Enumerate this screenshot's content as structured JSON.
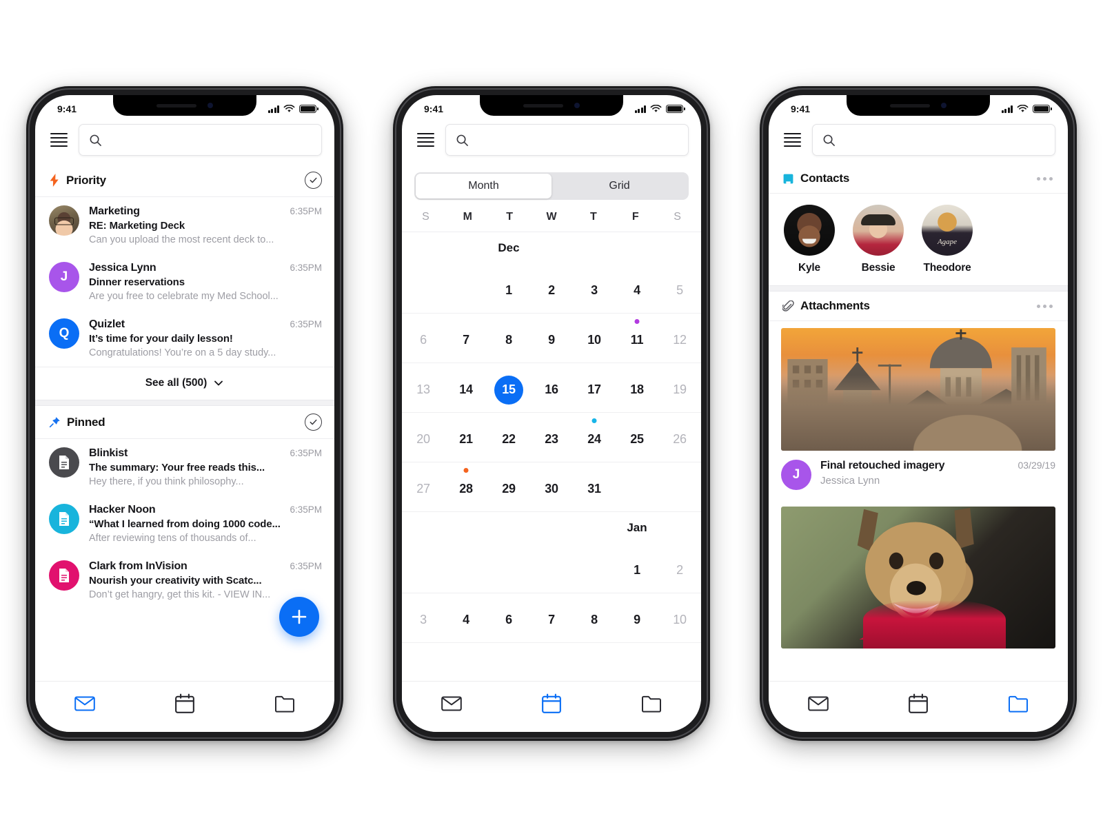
{
  "status": {
    "time": "9:41"
  },
  "search": {
    "placeholder": "",
    "value": "",
    "icon": "search-icon"
  },
  "phone_mail": {
    "priority": {
      "title": "Priority",
      "icon": "lightning-bolt-icon",
      "icon_color": "#f4631e",
      "action_icon": "check-circle-icon",
      "items": [
        {
          "from": "Marketing",
          "time": "6:35PM",
          "subject": "RE: Marketing Deck",
          "preview": "Can you upload the most recent deck to...",
          "avatar_type": "photo",
          "avatar_initial": ""
        },
        {
          "from": "Jessica Lynn",
          "time": "6:35PM",
          "subject": "Dinner reservations",
          "preview": "Are you free to celebrate my Med School...",
          "avatar_type": "initial",
          "avatar_initial": "J",
          "avatar_color": "#a855ea"
        },
        {
          "from": "Quizlet",
          "time": "6:35PM",
          "subject": "It’s time for your daily lesson!",
          "preview": "Congratulations! You’re on a 5 day study...",
          "avatar_type": "initial",
          "avatar_initial": "Q",
          "avatar_color": "#0a6ef5"
        }
      ],
      "see_all": "See all (500)",
      "see_all_icon": "chevron-down-icon"
    },
    "pinned": {
      "title": "Pinned",
      "icon": "pin-icon",
      "icon_color": "#1672f0",
      "action_icon": "check-circle-icon",
      "items": [
        {
          "from": "Blinkist",
          "time": "6:35PM",
          "subject": "The summary: Your free reads this...",
          "preview": "Hey there, if you think philosophy...",
          "avatar_type": "doc",
          "avatar_color": "#4a4a4e"
        },
        {
          "from": "Hacker Noon",
          "time": "6:35PM",
          "subject": "“What I learned from doing 1000 code...",
          "preview": "After reviewing tens of thousands of...",
          "avatar_type": "doc",
          "avatar_color": "#18b4dc"
        },
        {
          "from": "Clark from InVision",
          "time": "6:35PM",
          "subject": "Nourish your creativity with Scatc...",
          "preview": "Don’t get hangry, get this kit. - VIEW IN...",
          "avatar_type": "doc",
          "avatar_color": "#e1116e"
        }
      ]
    },
    "fab": {
      "label": "+",
      "icon": "plus-icon",
      "color": "#0a6ef5"
    },
    "tabs": [
      {
        "name": "mail",
        "icon": "mail-icon",
        "active": true
      },
      {
        "name": "calendar",
        "icon": "calendar-icon",
        "active": false
      },
      {
        "name": "folder",
        "icon": "folder-icon",
        "active": false
      }
    ]
  },
  "phone_calendar": {
    "segments": [
      {
        "label": "Month",
        "active": true
      },
      {
        "label": "Grid",
        "active": false
      }
    ],
    "weekdays": [
      "S",
      "M",
      "T",
      "W",
      "T",
      "F",
      "S"
    ],
    "month_labels": [
      {
        "text": "Dec",
        "col": 2
      },
      {
        "text": "Jan",
        "col": 5
      }
    ],
    "selected_day": "15",
    "rows": [
      {
        "type": "label",
        "text": "Dec",
        "col": 2
      },
      {
        "type": "days",
        "cells": [
          {
            "n": "",
            "muted": true
          },
          {
            "n": "",
            "muted": true
          },
          {
            "n": "1",
            "muted": false
          },
          {
            "n": "2",
            "muted": false
          },
          {
            "n": "3",
            "muted": false
          },
          {
            "n": "4",
            "muted": false
          },
          {
            "n": "5",
            "muted": true
          }
        ]
      },
      {
        "type": "days",
        "cells": [
          {
            "n": "6",
            "muted": true
          },
          {
            "n": "7",
            "muted": false
          },
          {
            "n": "8",
            "muted": false
          },
          {
            "n": "9",
            "muted": false
          },
          {
            "n": "10",
            "muted": false
          },
          {
            "n": "11",
            "muted": false,
            "dot": "#b23ae0"
          },
          {
            "n": "12",
            "muted": true
          }
        ]
      },
      {
        "type": "days",
        "cells": [
          {
            "n": "13",
            "muted": true
          },
          {
            "n": "14",
            "muted": false
          },
          {
            "n": "15",
            "muted": false,
            "today": true
          },
          {
            "n": "16",
            "muted": false
          },
          {
            "n": "17",
            "muted": false
          },
          {
            "n": "18",
            "muted": false
          },
          {
            "n": "19",
            "muted": true
          }
        ]
      },
      {
        "type": "days",
        "cells": [
          {
            "n": "20",
            "muted": true
          },
          {
            "n": "21",
            "muted": false
          },
          {
            "n": "22",
            "muted": false
          },
          {
            "n": "23",
            "muted": false
          },
          {
            "n": "24",
            "muted": false,
            "dot": "#17b5e8"
          },
          {
            "n": "25",
            "muted": false
          },
          {
            "n": "26",
            "muted": true
          }
        ]
      },
      {
        "type": "days",
        "cells": [
          {
            "n": "27",
            "muted": true
          },
          {
            "n": "28",
            "muted": false,
            "dot": "#f4631e"
          },
          {
            "n": "29",
            "muted": false
          },
          {
            "n": "30",
            "muted": false
          },
          {
            "n": "31",
            "muted": false
          },
          {
            "n": "",
            "muted": true
          },
          {
            "n": "",
            "muted": true
          }
        ]
      },
      {
        "type": "label",
        "text": "Jan",
        "col": 5
      },
      {
        "type": "days",
        "cells": [
          {
            "n": "",
            "muted": true
          },
          {
            "n": "",
            "muted": true
          },
          {
            "n": "",
            "muted": true
          },
          {
            "n": "",
            "muted": true
          },
          {
            "n": "",
            "muted": true
          },
          {
            "n": "1",
            "muted": false
          },
          {
            "n": "2",
            "muted": true
          }
        ]
      },
      {
        "type": "days",
        "cells": [
          {
            "n": "3",
            "muted": true
          },
          {
            "n": "4",
            "muted": false
          },
          {
            "n": "6",
            "muted": false
          },
          {
            "n": "7",
            "muted": false
          },
          {
            "n": "8",
            "muted": false
          },
          {
            "n": "9",
            "muted": false
          },
          {
            "n": "10",
            "muted": true
          }
        ]
      }
    ],
    "tabs": [
      {
        "name": "mail",
        "icon": "mail-icon",
        "active": false
      },
      {
        "name": "calendar",
        "icon": "calendar-icon",
        "active": true
      },
      {
        "name": "folder",
        "icon": "folder-icon",
        "active": false
      }
    ]
  },
  "phone_files": {
    "contacts_section": {
      "title": "Contacts",
      "icon": "book-icon",
      "icon_color": "#18b4dc",
      "menu_icon": "more-horizontal-icon",
      "people": [
        {
          "name": "Kyle",
          "avatar": "photo-kyle"
        },
        {
          "name": "Bessie",
          "avatar": "photo-bessie"
        },
        {
          "name": "Theodore",
          "avatar": "photo-theodore"
        }
      ]
    },
    "attachments_section": {
      "title": "Attachments",
      "icon": "paperclip-icon",
      "menu_icon": "more-horizontal-icon",
      "items": [
        {
          "image": "church-photo",
          "download_icon": "download-icon",
          "title": "Final retouched imagery",
          "date": "03/29/19",
          "author": "Jessica Lynn",
          "avatar_initial": "J",
          "avatar_color": "#a855ea"
        },
        {
          "image": "dog-photo"
        }
      ]
    },
    "tabs": [
      {
        "name": "mail",
        "icon": "mail-icon",
        "active": false
      },
      {
        "name": "calendar",
        "icon": "calendar-icon",
        "active": false
      },
      {
        "name": "folder",
        "icon": "folder-icon",
        "active": true
      }
    ]
  }
}
